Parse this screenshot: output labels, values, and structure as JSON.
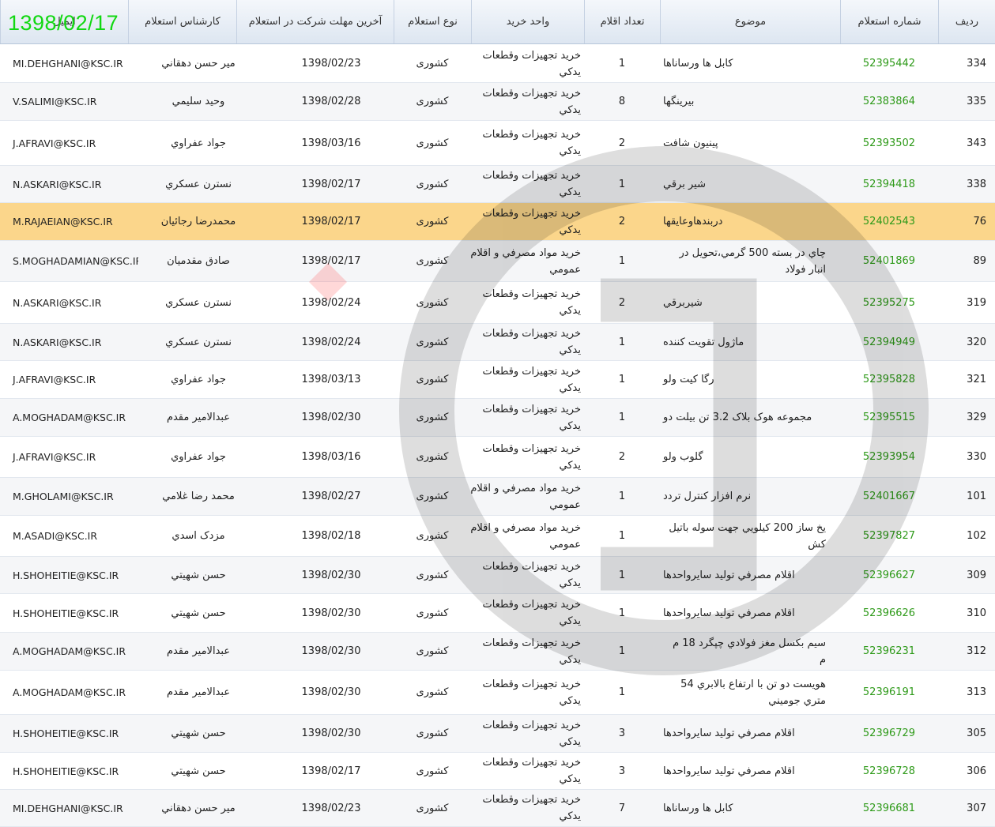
{
  "header": {
    "radif": "ردیف",
    "number": "شماره استعلام",
    "subject": "موضوع",
    "count": "تعداد اقلام",
    "unit": "واحد خرید",
    "type": "نوع استعلام",
    "deadline": "آخرین مهلت شرکت در استعلام",
    "expert": "کارشناس استعلام",
    "email": "ایمیل"
  },
  "date_overlay": "1398/02/17",
  "rows": [
    {
      "radif": "334",
      "number": "52395442",
      "subject": "كابل ها ورسانا‌ها",
      "count": "1",
      "unit": "خريد تجهيزات وقطعات يدكي",
      "type": "کشوری",
      "deadline": "1398/02/23",
      "expert": "مير حسن دهقاني",
      "email": "MI.DEHGHANI@KSC.IR"
    },
    {
      "radif": "335",
      "number": "52383864",
      "subject": "بيرينگها",
      "count": "8",
      "unit": "خريد تجهيزات وقطعات يدكي",
      "type": "کشوری",
      "deadline": "1398/02/28",
      "expert": "وحيد سليمي",
      "email": "V.SALIMI@KSC.IR"
    },
    {
      "radif": "343",
      "number": "52393502",
      "subject": "پينيون شافت",
      "count": "2",
      "unit": "خريد تجهيزات وقطعات يدكي",
      "type": "کشوری",
      "deadline": "1398/03/16",
      "expert": "جواد عفراوي",
      "email": "J.AFRAVI@KSC.IR"
    },
    {
      "radif": "338",
      "number": "52394418",
      "subject": "شير برقي",
      "count": "1",
      "unit": "خريد تجهيزات وقطعات يدكي",
      "type": "کشوری",
      "deadline": "1398/02/17",
      "expert": "نسترن عسكري",
      "email": "N.ASKARI@KSC.IR"
    },
    {
      "radif": "76",
      "number": "52402543",
      "subject": "دربندهاوعايقها",
      "count": "2",
      "unit": "خريد تجهيزات وقطعات يدكي",
      "type": "کشوری",
      "deadline": "1398/02/17",
      "expert": "محمدرضا رجائيان",
      "email": "M.RAJAEIAN@KSC.IR"
    },
    {
      "radif": "89",
      "number": "52401869",
      "subject": "چاي در بسته 500 گرمي،تحويل در انبار فولاد",
      "count": "1",
      "unit": "خريد مواد مصرفي و اقلام عمومي",
      "type": "کشوری",
      "deadline": "1398/02/17",
      "expert": "صادق مقدميان",
      "email": "S.MOGHADAMIAN@KSC.IR"
    },
    {
      "radif": "319",
      "number": "52395275",
      "subject": "شيربرقي",
      "count": "2",
      "unit": "خريد تجهيزات وقطعات يدكي",
      "type": "کشوری",
      "deadline": "1398/02/24",
      "expert": "نسترن عسكري",
      "email": "N.ASKARI@KSC.IR"
    },
    {
      "radif": "320",
      "number": "52394949",
      "subject": "ماژول تقويت كننده",
      "count": "1",
      "unit": "خريد تجهيزات وقطعات يدكي",
      "type": "کشوری",
      "deadline": "1398/02/24",
      "expert": "نسترن عسكري",
      "email": "N.ASKARI@KSC.IR"
    },
    {
      "radif": "321",
      "number": "52395828",
      "subject": "رگا كيت ولو",
      "count": "1",
      "unit": "خريد تجهيزات وقطعات يدكي",
      "type": "کشوری",
      "deadline": "1398/03/13",
      "expert": "جواد عفراوي",
      "email": "J.AFRAVI@KSC.IR"
    },
    {
      "radif": "329",
      "number": "52395515",
      "subject": "مجموعه هوک بلاک 3.2 تن بیلت دو",
      "count": "1",
      "unit": "خريد تجهيزات وقطعات يدكي",
      "type": "کشوری",
      "deadline": "1398/02/30",
      "expert": "عبدالامير مقدم",
      "email": "A.MOGHADAM@KSC.IR"
    },
    {
      "radif": "330",
      "number": "52393954",
      "subject": "گلوب ولو",
      "count": "2",
      "unit": "خريد تجهيزات وقطعات يدكي",
      "type": "کشوری",
      "deadline": "1398/03/16",
      "expert": "جواد عفراوي",
      "email": "J.AFRAVI@KSC.IR"
    },
    {
      "radif": "101",
      "number": "52401667",
      "subject": "نرم افزار کنترل تردد",
      "count": "1",
      "unit": "خريد مواد مصرفي و اقلام عمومي",
      "type": "کشوری",
      "deadline": "1398/02/27",
      "expert": "محمد رضا غلامي",
      "email": "M.GHOLAMI@KSC.IR"
    },
    {
      "radif": "102",
      "number": "52397827",
      "subject": "يخ ساز 200 كيلويي جهت سوله باتيل كش",
      "count": "1",
      "unit": "خريد مواد مصرفي و اقلام عمومي",
      "type": "کشوری",
      "deadline": "1398/02/18",
      "expert": "مزدک اسدي",
      "email": "M.ASADI@KSC.IR"
    },
    {
      "radif": "309",
      "number": "52396627",
      "subject": "اقلام مصرفي توليد سايرواحدها",
      "count": "1",
      "unit": "خريد تجهيزات وقطعات يدكي",
      "type": "کشوری",
      "deadline": "1398/02/30",
      "expert": "حسن شهيتي",
      "email": "H.SHOHEITIE@KSC.IR"
    },
    {
      "radif": "310",
      "number": "52396626",
      "subject": "اقلام مصرفي توليد سايرواحدها",
      "count": "1",
      "unit": "خريد تجهيزات وقطعات يدكي",
      "type": "کشوری",
      "deadline": "1398/02/30",
      "expert": "حسن شهيتي",
      "email": "H.SHOHEITIE@KSC.IR"
    },
    {
      "radif": "312",
      "number": "52396231",
      "subject": "سيم بكسل مغز فولادي چپگرد 18 م م",
      "count": "1",
      "unit": "خريد تجهيزات وقطعات يدكي",
      "type": "کشوری",
      "deadline": "1398/02/30",
      "expert": "عبدالامير مقدم",
      "email": "A.MOGHADAM@KSC.IR"
    },
    {
      "radif": "313",
      "number": "52396191",
      "subject": "هويست دو تن با ارتفاع بالابري 54 متري جوميني",
      "count": "1",
      "unit": "خريد تجهيزات وقطعات يدكي",
      "type": "کشوری",
      "deadline": "1398/02/30",
      "expert": "عبدالامير مقدم",
      "email": "A.MOGHADAM@KSC.IR"
    },
    {
      "radif": "305",
      "number": "52396729",
      "subject": "اقلام مصرفي توليد سايرواحدها",
      "count": "3",
      "unit": "خريد تجهيزات وقطعات يدكي",
      "type": "کشوری",
      "deadline": "1398/02/30",
      "expert": "حسن شهيتي",
      "email": "H.SHOHEITIE@KSC.IR"
    },
    {
      "radif": "306",
      "number": "52396728",
      "subject": "اقلام مصرفي توليد سايرواحدها",
      "count": "3",
      "unit": "خريد تجهيزات وقطعات يدكي",
      "type": "کشوری",
      "deadline": "1398/02/17",
      "expert": "حسن شهيتي",
      "email": "H.SHOHEITIE@KSC.IR"
    },
    {
      "radif": "307",
      "number": "52396681",
      "subject": "كابل ها ورسانا‌ها",
      "count": "7",
      "unit": "خريد تجهيزات وقطعات يدكي",
      "type": "کشوری",
      "deadline": "1398/02/23",
      "expert": "مير حسن دهقاني",
      "email": "MI.DEHGHANI@KSC.IR"
    }
  ],
  "colors": {
    "highlight": "#fbd68b",
    "number_link": "#2e9a19",
    "date_overlay": "#12d812"
  }
}
